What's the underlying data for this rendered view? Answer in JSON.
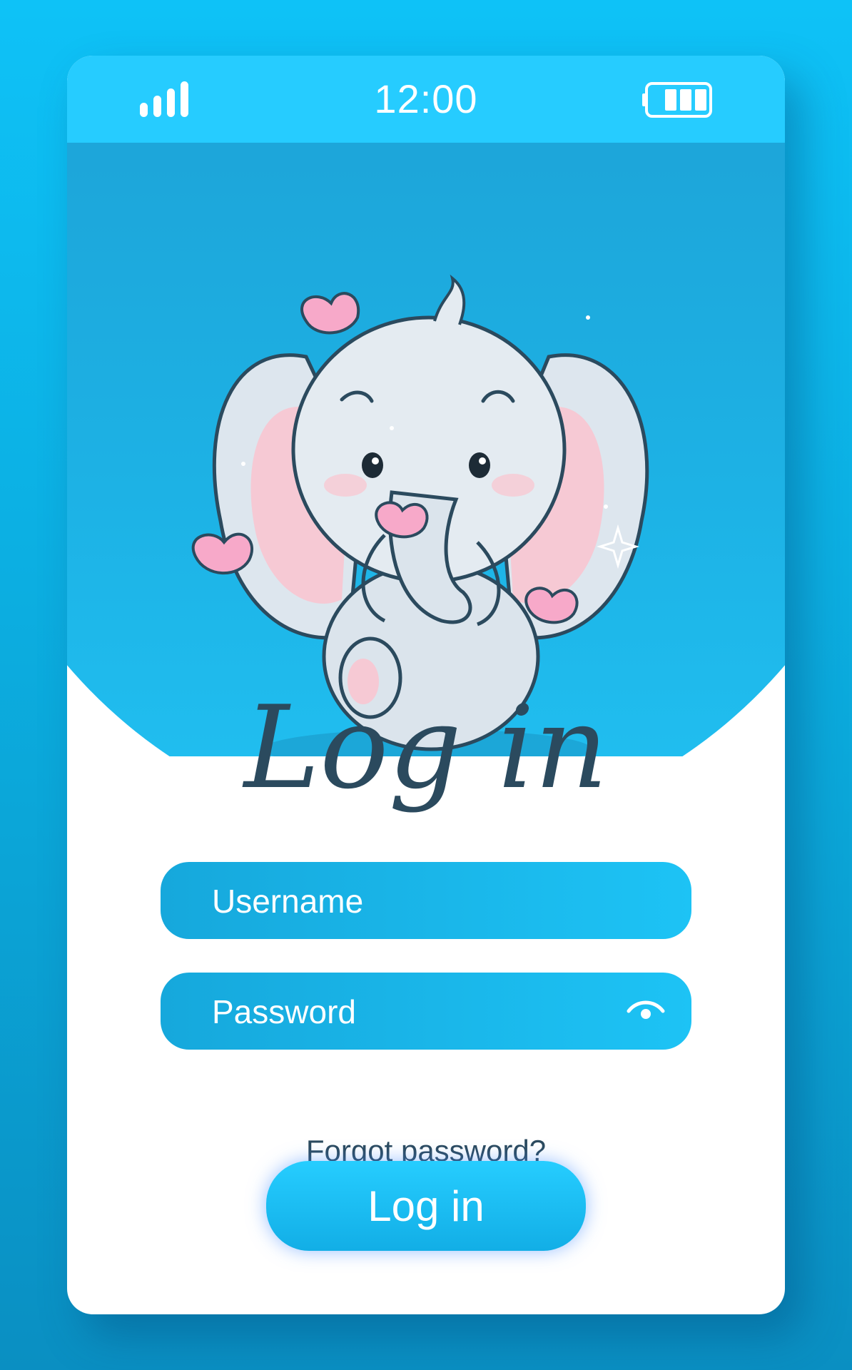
{
  "status_bar": {
    "time": "12:00",
    "signal_icon": "signal-bars-icon",
    "battery_icon": "battery-icon"
  },
  "hero": {
    "illustration": "cute-elephant-with-butterflies"
  },
  "title": "Log in",
  "form": {
    "username": {
      "placeholder": "Username",
      "value": ""
    },
    "password": {
      "placeholder": "Password",
      "value": "",
      "toggle_icon": "eye-icon"
    },
    "forgot_label": "Forgot password?",
    "submit_label": "Log in"
  },
  "colors": {
    "background": "#0ec2f7",
    "status_bar": "#26ccff",
    "hero_blue": "#1da4d8",
    "field_gradient_start": "#16a8dc",
    "field_gradient_end": "#1dc3f5",
    "text_dark": "#2b4a5e",
    "button": "#26cdff"
  }
}
